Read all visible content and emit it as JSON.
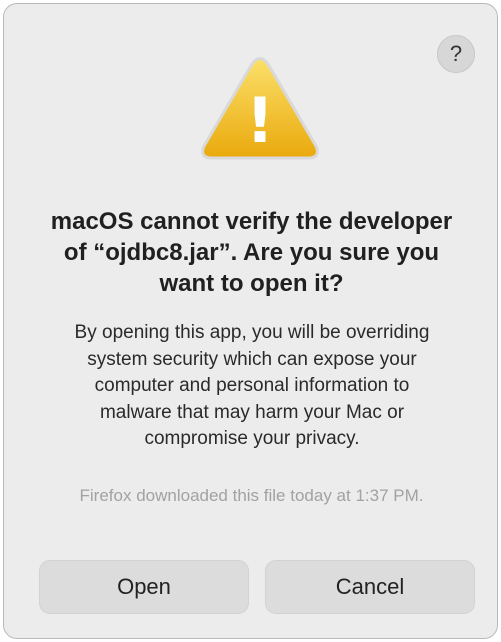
{
  "dialog": {
    "help_label": "?",
    "title": "macOS cannot verify the developer of “ojdbc8.jar”. Are you sure you want to open it?",
    "message": "By opening this app, you will be overriding system security which can expose your computer and personal information to malware that may harm your Mac or compromise your privacy.",
    "source_note": "Firefox downloaded this file today at 1:37 PM.",
    "buttons": {
      "open_label": "Open",
      "cancel_label": "Cancel"
    },
    "icon": {
      "name": "warning-icon",
      "glyph": "!",
      "color_top": "#f9d64a",
      "color_bottom": "#e9a80a"
    }
  }
}
